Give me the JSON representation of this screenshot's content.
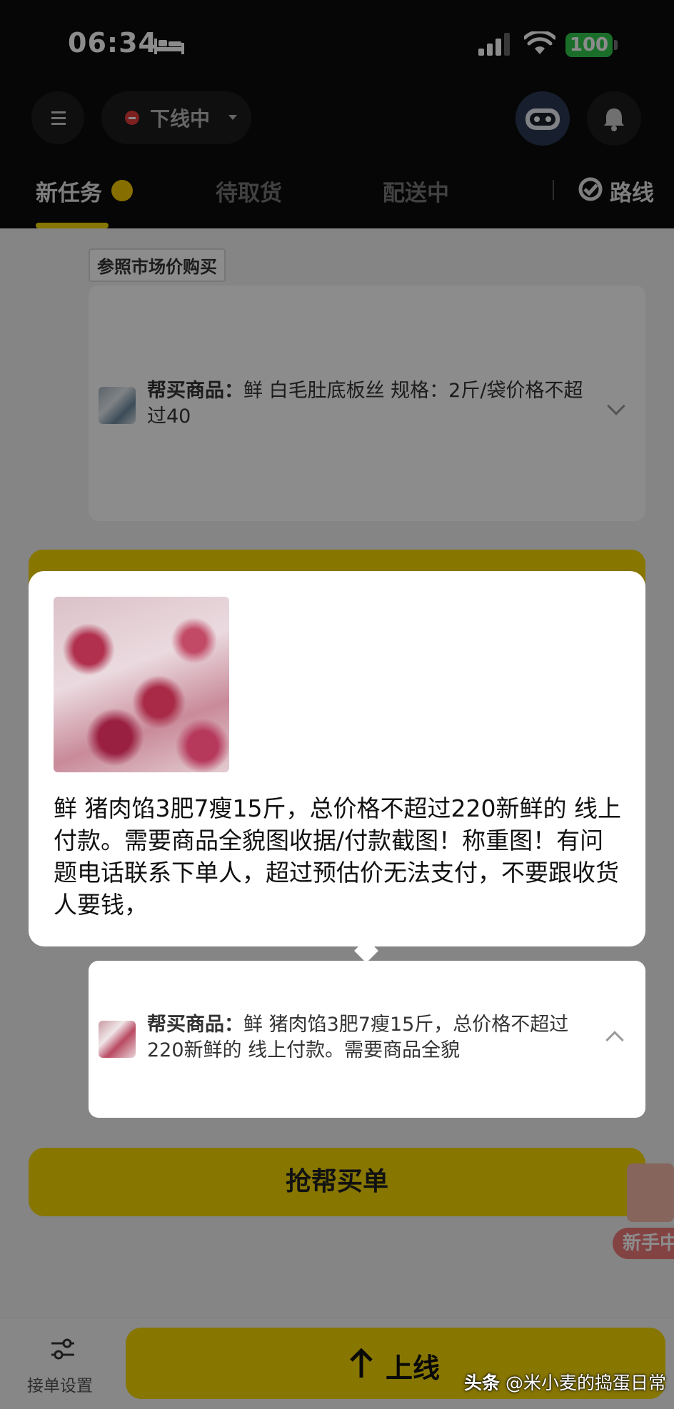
{
  "status_bar": {
    "time": "06:34",
    "battery": "100"
  },
  "header": {
    "online_status": "下线中",
    "tabs": [
      {
        "label": "新任务"
      },
      {
        "label": "待取货"
      },
      {
        "label": "配送中"
      },
      {
        "label": "路线"
      }
    ]
  },
  "orders": {
    "market_tag": "参照市场价购买",
    "order1": {
      "title_prefix": "帮买商品：",
      "description": "鲜 白毛肚底板丝  规格：2斤/袋价格不超过40"
    },
    "order2": {
      "title_prefix": "帮买商品：",
      "description": "鲜 猪肉馅3肥7瘦15斤，总价格不超过220新鲜的 线上付款。需要商品全貌"
    },
    "grab_button": "抢帮买单",
    "newbie_tag": "新手中"
  },
  "popup": {
    "text": "鲜 猪肉馅3肥7瘦15斤，总价格不超过220新鲜的 线上付款。需要商品全貌图收据/付款截图！称重图！有问题电话联系下单人，超过预估价无法支付，不要跟收货人要钱，"
  },
  "bottom_bar": {
    "settings_label": "接单设置",
    "online_button": "上线"
  },
  "watermark": {
    "brand": "头条",
    "handle": "@米小麦的捣蛋日常"
  },
  "colors": {
    "accent_yellow": "#f6d800",
    "dark_header": "#0b0b0b",
    "offline_red": "#e23b3b",
    "battery_green": "#32c94e"
  }
}
